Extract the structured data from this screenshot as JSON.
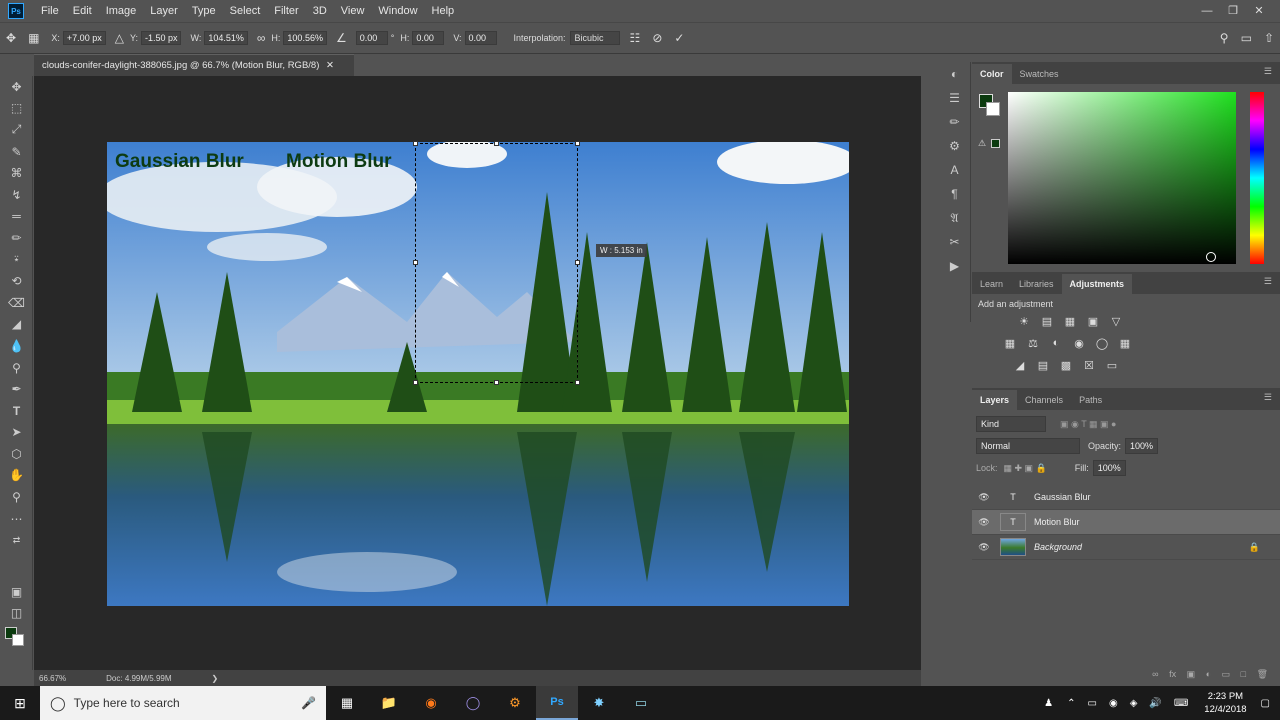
{
  "app": {
    "logo": "Ps",
    "menus": [
      "File",
      "Edit",
      "Image",
      "Layer",
      "Type",
      "Select",
      "Filter",
      "3D",
      "View",
      "Window",
      "Help"
    ]
  },
  "options": {
    "x_label": "X:",
    "x_value": "+7.00 px",
    "y_label": "Y:",
    "y_value": "-1.50 px",
    "w_label": "W:",
    "w_value": "104.51%",
    "h_label": "H:",
    "h_value": "100.56%",
    "angle_value": "0.00",
    "angle_unit": "°",
    "hskew_label": "H:",
    "hskew_value": "0.00",
    "vskew_label": "V:",
    "vskew_value": "0.00",
    "interp_label": "Interpolation:",
    "interp_value": "Bicubic"
  },
  "document": {
    "tab_title": "clouds-conifer-daylight-388065.jpg @ 66.7% (Motion Blur, RGB/8)",
    "text_gaussian": "Gaussian Blur",
    "text_motion": "Motion Blur",
    "tooltip": "W : 5.153 in",
    "zoom": "66.67%",
    "doc_size": "Doc: 4.99M/5.99M"
  },
  "color_panel": {
    "tabs": [
      "Color",
      "Swatches"
    ],
    "fg_color": "#0b3a0f",
    "bg_color": "#ffffff"
  },
  "adjust_panel": {
    "tabs": [
      "Learn",
      "Libraries",
      "Adjustments"
    ],
    "heading": "Add an adjustment"
  },
  "layers_panel": {
    "tabs": [
      "Layers",
      "Channels",
      "Paths"
    ],
    "kind_placeholder": "Kind",
    "blend_mode": "Normal",
    "opacity_label": "Opacity:",
    "opacity_value": "100%",
    "lock_label": "Lock:",
    "fill_label": "Fill:",
    "fill_value": "100%",
    "layers": [
      {
        "name": "Gaussian Blur",
        "type": "text"
      },
      {
        "name": "Motion Blur",
        "type": "text",
        "selected": true
      },
      {
        "name": "Background",
        "type": "image",
        "locked": true
      }
    ]
  },
  "taskbar": {
    "search_placeholder": "Type here to search",
    "time": "2:23 PM",
    "date": "12/4/2018"
  }
}
